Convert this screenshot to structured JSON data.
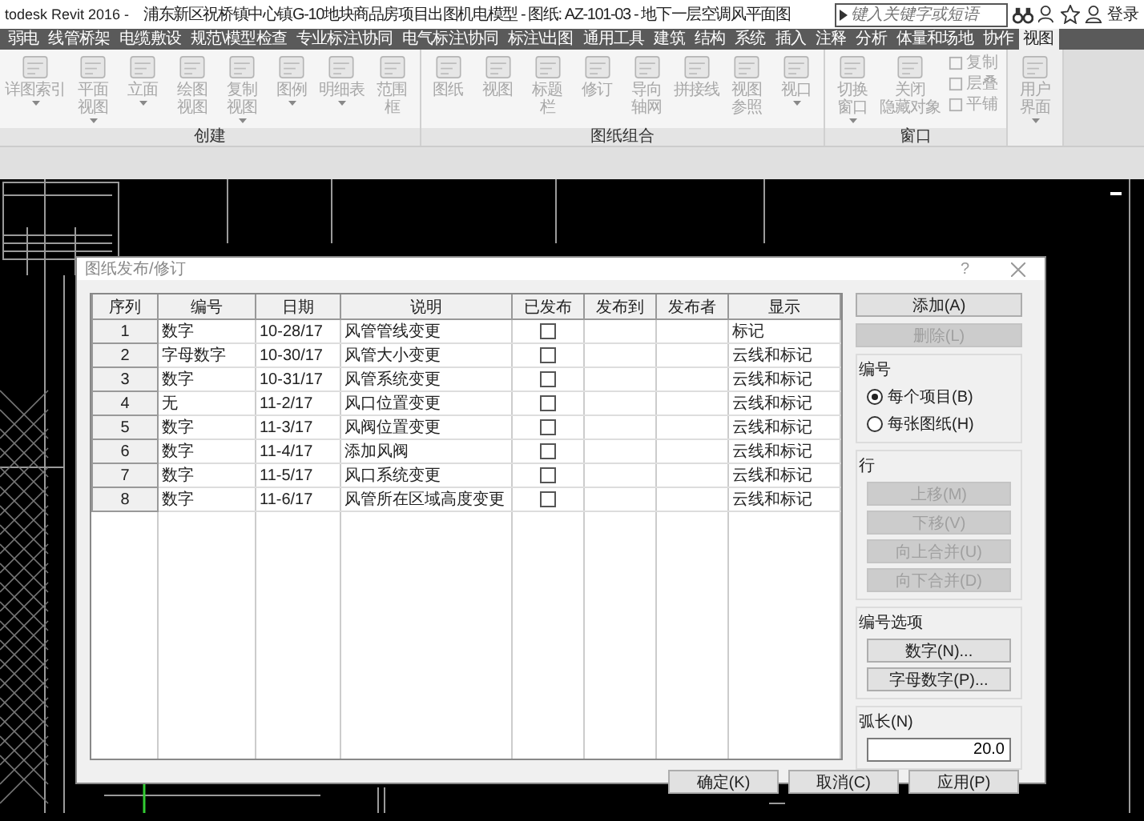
{
  "window": {
    "app_title": "todesk Revit 2016 -",
    "document_title": "浦东新区祝桥镇中心镇G-10地块商品房项目出图机电模型 - 图纸: AZ-101-03 - 地下一层空调风平面图",
    "sign_in": "登录"
  },
  "search": {
    "placeholder": "键入关键字或短语"
  },
  "ribbon_tabs": [
    {
      "label": "弱电",
      "selected": false
    },
    {
      "label": "线管桥架",
      "selected": false
    },
    {
      "label": "电缆敷设",
      "selected": false
    },
    {
      "label": "规范\\模型检查",
      "selected": false
    },
    {
      "label": "专业标注\\协同",
      "selected": false
    },
    {
      "label": "电气标注\\协同",
      "selected": false
    },
    {
      "label": "标注\\出图",
      "selected": false
    },
    {
      "label": "通用工具",
      "selected": false
    },
    {
      "label": "建筑",
      "selected": false
    },
    {
      "label": "结构",
      "selected": false
    },
    {
      "label": "系统",
      "selected": false
    },
    {
      "label": "插入",
      "selected": false
    },
    {
      "label": "注释",
      "selected": false
    },
    {
      "label": "分析",
      "selected": false
    },
    {
      "label": "体量和场地",
      "selected": false
    },
    {
      "label": "协作",
      "selected": false
    },
    {
      "label": "视图",
      "selected": true
    }
  ],
  "ribbon_panels": [
    {
      "label": "创建",
      "tools": [
        {
          "kind": "large",
          "lines": [
            "详图索引"
          ],
          "has_menu": true
        },
        {
          "kind": "large",
          "lines": [
            "平面",
            "视图"
          ],
          "has_menu": true
        },
        {
          "kind": "large",
          "lines": [
            "立面"
          ],
          "has_menu": true
        },
        {
          "kind": "large",
          "lines": [
            "绘图",
            "视图"
          ],
          "has_menu": false
        },
        {
          "kind": "large",
          "lines": [
            "复制",
            "视图"
          ],
          "has_menu": true
        },
        {
          "kind": "large",
          "lines": [
            "图例"
          ],
          "has_menu": true
        },
        {
          "kind": "large",
          "lines": [
            "明细表"
          ],
          "has_menu": true
        },
        {
          "kind": "large",
          "lines": [
            "范围",
            "框"
          ],
          "has_menu": false
        }
      ]
    },
    {
      "label": "图纸组合",
      "tools": [
        {
          "kind": "large",
          "lines": [
            "图纸"
          ],
          "has_menu": false
        },
        {
          "kind": "large",
          "lines": [
            "视图"
          ],
          "has_menu": false
        },
        {
          "kind": "large",
          "lines": [
            "标题",
            "栏"
          ],
          "has_menu": false
        },
        {
          "kind": "large",
          "lines": [
            "修订"
          ],
          "has_menu": false
        },
        {
          "kind": "large",
          "lines": [
            "导向",
            "轴网"
          ],
          "has_menu": false
        },
        {
          "kind": "large",
          "lines": [
            "拼接线"
          ],
          "has_menu": false
        },
        {
          "kind": "large",
          "lines": [
            "视图",
            "参照"
          ],
          "has_menu": false
        },
        {
          "kind": "large",
          "lines": [
            "视口"
          ],
          "has_menu": true
        }
      ]
    },
    {
      "label": "窗口",
      "tools": [
        {
          "kind": "large",
          "lines": [
            "切换",
            "窗口"
          ],
          "has_menu": true
        },
        {
          "kind": "large",
          "lines": [
            "关闭",
            "隐藏对象"
          ],
          "has_menu": false
        },
        {
          "kind": "small",
          "lines": [
            "复制",
            "层叠",
            "平铺"
          ]
        }
      ]
    },
    {
      "tools": [
        {
          "kind": "large",
          "lines": [
            "用户",
            "界面"
          ],
          "has_menu": true
        }
      ]
    }
  ],
  "dialog": {
    "title": "图纸发布/修订",
    "help": "?",
    "table": {
      "columns": [
        "序列",
        "编号",
        "日期",
        "说明",
        "已发布",
        "发布到",
        "发布者",
        "显示"
      ],
      "rows": [
        {
          "sequence": "1",
          "numbering": "数字",
          "date": "10-28/17",
          "description": "风管管线变更",
          "issued": false,
          "show": "标记"
        },
        {
          "sequence": "2",
          "numbering": "字母数字",
          "date": "10-30/17",
          "description": "风管大小变更",
          "issued": false,
          "show": "云线和标记"
        },
        {
          "sequence": "3",
          "numbering": "数字",
          "date": "10-31/17",
          "description": "风管系统变更",
          "issued": false,
          "show": "云线和标记"
        },
        {
          "sequence": "4",
          "numbering": "无",
          "date": "11-2/17",
          "description": "风口位置变更",
          "issued": false,
          "show": "云线和标记"
        },
        {
          "sequence": "5",
          "numbering": "数字",
          "date": "11-3/17",
          "description": "风阀位置变更",
          "issued": false,
          "show": "云线和标记"
        },
        {
          "sequence": "6",
          "numbering": "数字",
          "date": "11-4/17",
          "description": "添加风阀",
          "issued": false,
          "show": "云线和标记"
        },
        {
          "sequence": "7",
          "numbering": "数字",
          "date": "11-5/17",
          "description": "风口系统变更",
          "issued": false,
          "show": "云线和标记"
        },
        {
          "sequence": "8",
          "numbering": "数字",
          "date": "11-6/17",
          "description": "风管所在区域高度变更",
          "issued": false,
          "show": "云线和标记"
        }
      ]
    },
    "top_buttons": [
      {
        "label": "添加(A)",
        "disabled": false
      },
      {
        "label": "删除(L)",
        "disabled": true
      }
    ],
    "numbering": {
      "title": "编号",
      "options": [
        {
          "label": "每个项目(B)",
          "selected": true
        },
        {
          "label": "每张图纸(H)",
          "selected": false
        }
      ]
    },
    "row": {
      "title": "行",
      "buttons": [
        {
          "label": "上移(M)",
          "disabled": true
        },
        {
          "label": "下移(V)",
          "disabled": true
        },
        {
          "label": "向上合并(U)",
          "disabled": true
        },
        {
          "label": "向下合并(D)",
          "disabled": true
        }
      ]
    },
    "numbering_options": {
      "title": "编号选项",
      "buttons": [
        {
          "label": "数字(N)...",
          "disabled": false
        },
        {
          "label": "字母数字(P)...",
          "disabled": false
        }
      ]
    },
    "arc_length": {
      "label": "弧长(N)",
      "value": "20.0"
    },
    "footer_buttons": [
      {
        "label": "确定(K)",
        "disabled": false
      },
      {
        "label": "取消(C)",
        "disabled": false
      },
      {
        "label": "应用(P)",
        "disabled": false
      }
    ]
  }
}
